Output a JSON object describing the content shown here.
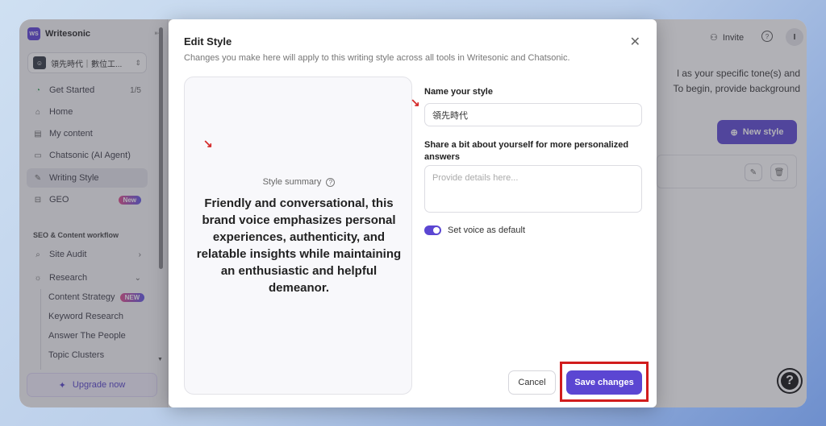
{
  "sidebar": {
    "brand": "Writesonic",
    "brand_logo": "WS",
    "workspace": {
      "name": "領先時代｜數位工...",
      "avatar": "?"
    },
    "items": [
      {
        "label": "Get Started",
        "count": "1/5",
        "icon": "progress-ring-icon"
      },
      {
        "label": "Home",
        "icon": "home-icon"
      },
      {
        "label": "My content",
        "icon": "document-icon"
      },
      {
        "label": "Chatsonic (AI Agent)",
        "icon": "chat-icon"
      },
      {
        "label": "Writing Style",
        "icon": "feather-icon"
      },
      {
        "label": "GEO",
        "badge": "New",
        "icon": "robot-icon"
      }
    ],
    "section_title": "SEO & Content workflow",
    "site_audit": "Site Audit",
    "research": "Research",
    "research_items": [
      {
        "label": "Content Strategy",
        "badge": "NEW"
      },
      {
        "label": "Keyword Research"
      },
      {
        "label": "Answer The People"
      },
      {
        "label": "Topic Clusters"
      }
    ],
    "upgrade_label": "Upgrade now"
  },
  "topbar": {
    "invite": "Invite",
    "avatar": "I"
  },
  "background": {
    "line1": "l as your specific tone(s) and",
    "line2": "To begin, provide background",
    "new_style": "New style"
  },
  "modal": {
    "title": "Edit Style",
    "subtitle": "Changes you make here will apply to this writing style across all tools in Writesonic and Chatsonic.",
    "summary_label": "Style summary",
    "summary_text": "Friendly and conversational, this brand voice emphasizes personal experiences, authenticity, and relatable insights while maintaining an enthusiastic and helpful demeanor.",
    "name_label": "Name your style",
    "name_value": "領先時代",
    "bio_label": "Share a bit about yourself for more personalized answers",
    "bio_placeholder": "Provide details here...",
    "default_label": "Set voice as default",
    "cancel": "Cancel",
    "save": "Save changes"
  },
  "colors": {
    "accent": "#5b46d2",
    "highlight": "#d11c1c"
  }
}
